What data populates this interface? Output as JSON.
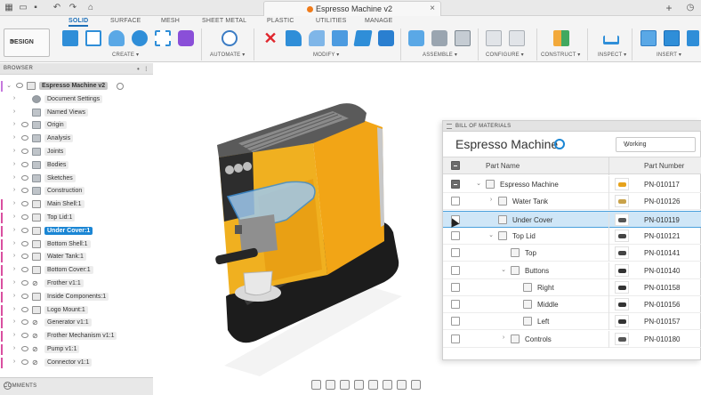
{
  "window": {
    "document_title": "Espresso Machine v2",
    "accent": "#1d6fb8"
  },
  "workspace_tabs": [
    {
      "label": "SOLID",
      "active": true
    },
    {
      "label": "SURFACE",
      "active": false
    },
    {
      "label": "MESH",
      "active": false
    },
    {
      "label": "SHEET METAL",
      "active": false
    },
    {
      "label": "PLASTIC",
      "active": false
    },
    {
      "label": "UTILITIES",
      "active": false
    },
    {
      "label": "MANAGE",
      "active": false
    }
  ],
  "design_button": {
    "label": "DESIGN"
  },
  "tool_groups": [
    {
      "label": "CREATE ▾"
    },
    {
      "label": "AUTOMATE ▾"
    },
    {
      "label": "MODIFY ▾"
    },
    {
      "label": "ASSEMBLE ▾"
    },
    {
      "label": "CONFIGURE ▾"
    },
    {
      "label": "CONSTRUCT ▾"
    },
    {
      "label": "INSPECT ▾"
    },
    {
      "label": "INSERT ▾"
    }
  ],
  "browser": {
    "header": "BROWSER",
    "items": [
      {
        "label": "Espresso Machine v2",
        "icon": "component-icon",
        "accent": "#c678dd"
      },
      {
        "label": "Document Settings",
        "icon": "gear-icon",
        "accent": ""
      },
      {
        "label": "Named Views",
        "icon": "folder-icon",
        "accent": ""
      },
      {
        "label": "Origin",
        "icon": "folder-icon",
        "accent": ""
      },
      {
        "label": "Analysis",
        "icon": "folder-icon",
        "accent": ""
      },
      {
        "label": "Joints",
        "icon": "folder-icon",
        "accent": ""
      },
      {
        "label": "Bodies",
        "icon": "folder-icon",
        "accent": ""
      },
      {
        "label": "Sketches",
        "icon": "folder-icon",
        "accent": ""
      },
      {
        "label": "Construction",
        "icon": "folder-icon",
        "accent": ""
      },
      {
        "label": "Main Shell:1",
        "icon": "component-icon",
        "accent": "#d94fa0"
      },
      {
        "label": "Top Lid:1",
        "icon": "component-icon",
        "accent": "#d94fa0"
      },
      {
        "label": "Under Cover:1",
        "icon": "component-icon",
        "accent": "#d94fa0"
      },
      {
        "label": "Bottom Shell:1",
        "icon": "component-icon",
        "accent": "#d94fa0"
      },
      {
        "label": "Water Tank:1",
        "icon": "component-icon",
        "accent": "#d94fa0"
      },
      {
        "label": "Bottom Cover:1",
        "icon": "component-icon",
        "accent": "#d94fa0"
      },
      {
        "label": "Frother v1:1",
        "icon": "link-icon",
        "accent": "#d94fa0"
      },
      {
        "label": "Inside Components:1",
        "icon": "component-icon",
        "accent": "#d94fa0"
      },
      {
        "label": "Logo Mount:1",
        "icon": "component-icon",
        "accent": "#d94fa0"
      },
      {
        "label": "Generator v1:1",
        "icon": "link-icon",
        "accent": "#d94fa0"
      },
      {
        "label": "Frother Mechanism v1:1",
        "icon": "link-icon",
        "accent": "#d94fa0"
      },
      {
        "label": "Pump v1:1",
        "icon": "link-icon",
        "accent": "#d94fa0"
      },
      {
        "label": "Connector v1:1",
        "icon": "link-icon",
        "accent": "#d94fa0"
      }
    ]
  },
  "comments": {
    "label": "COMMENTS"
  },
  "bom": {
    "header": "BILL OF MATERIALS",
    "title": "Espresso Machine",
    "status": "Working",
    "col_part_name": "Part Name",
    "col_part_number": "Part Number",
    "rows": [
      {
        "name": "Espresso Machine",
        "number": "PN-010117",
        "depth": 0,
        "expand": "v",
        "thumb": "#e6a21b",
        "selected": false,
        "checked": true
      },
      {
        "name": "Water Tank",
        "number": "PN-010126",
        "depth": 1,
        "expand": ">",
        "thumb": "#c9a24a",
        "selected": false,
        "checked": false
      },
      {
        "name": "Under Cover",
        "number": "PN-010119",
        "depth": 1,
        "expand": "",
        "thumb": "#555555",
        "selected": true,
        "checked": false
      },
      {
        "name": "Top Lid",
        "number": "PN-010121",
        "depth": 1,
        "expand": "v",
        "thumb": "#444444",
        "selected": false,
        "checked": false
      },
      {
        "name": "Top",
        "number": "PN-010141",
        "depth": 2,
        "expand": "",
        "thumb": "#444444",
        "selected": false,
        "checked": false
      },
      {
        "name": "Buttons",
        "number": "PN-010140",
        "depth": 2,
        "expand": "v",
        "thumb": "#333333",
        "selected": false,
        "checked": false
      },
      {
        "name": "Right",
        "number": "PN-010158",
        "depth": 3,
        "expand": "",
        "thumb": "#333333",
        "selected": false,
        "checked": false
      },
      {
        "name": "Middle",
        "number": "PN-010156",
        "depth": 3,
        "expand": "",
        "thumb": "#333333",
        "selected": false,
        "checked": false
      },
      {
        "name": "Left",
        "number": "PN-010157",
        "depth": 3,
        "expand": "",
        "thumb": "#333333",
        "selected": false,
        "checked": false
      },
      {
        "name": "Controls",
        "number": "PN-010180",
        "depth": 2,
        "expand": ">",
        "thumb": "#555555",
        "selected": false,
        "checked": false
      }
    ]
  }
}
